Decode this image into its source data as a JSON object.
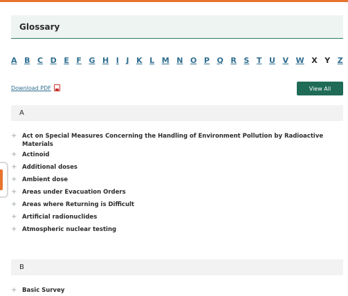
{
  "glossary": {
    "title": "Glossary"
  },
  "alphabet": [
    {
      "letter": "A",
      "linked": true
    },
    {
      "letter": "B",
      "linked": true
    },
    {
      "letter": "C",
      "linked": true
    },
    {
      "letter": "D",
      "linked": true
    },
    {
      "letter": "E",
      "linked": true
    },
    {
      "letter": "F",
      "linked": true
    },
    {
      "letter": "G",
      "linked": true
    },
    {
      "letter": "H",
      "linked": true
    },
    {
      "letter": "I",
      "linked": true
    },
    {
      "letter": "J",
      "linked": true
    },
    {
      "letter": "K",
      "linked": true
    },
    {
      "letter": "L",
      "linked": true
    },
    {
      "letter": "M",
      "linked": true
    },
    {
      "letter": "N",
      "linked": true
    },
    {
      "letter": "O",
      "linked": true
    },
    {
      "letter": "P",
      "linked": true
    },
    {
      "letter": "Q",
      "linked": true
    },
    {
      "letter": "R",
      "linked": true
    },
    {
      "letter": "S",
      "linked": true
    },
    {
      "letter": "T",
      "linked": true
    },
    {
      "letter": "U",
      "linked": true
    },
    {
      "letter": "V",
      "linked": true
    },
    {
      "letter": "W",
      "linked": true
    },
    {
      "letter": "X",
      "linked": false
    },
    {
      "letter": "Y",
      "linked": false
    },
    {
      "letter": "Z",
      "linked": true
    }
  ],
  "download": {
    "label": "Download PDF",
    "icon": "pdf-icon"
  },
  "view_all": {
    "label": "View All"
  },
  "sections": [
    {
      "letter": "A",
      "items": [
        "Act on Special Measures Concerning the Handling of Environment Pollution by Radioactive Materials",
        "Actinoid",
        "Additional doses",
        "Ambient dose",
        "Areas under Evacuation Orders",
        "Areas where Returning is Difficult",
        "Artificial radionuclides",
        "Atmospheric nuclear testing"
      ]
    },
    {
      "letter": "B",
      "items": [
        "Basic Survey"
      ]
    }
  ],
  "colors": {
    "accent": "#e8742e",
    "brand_green": "#1f6b56",
    "link": "#2f6d8f"
  }
}
